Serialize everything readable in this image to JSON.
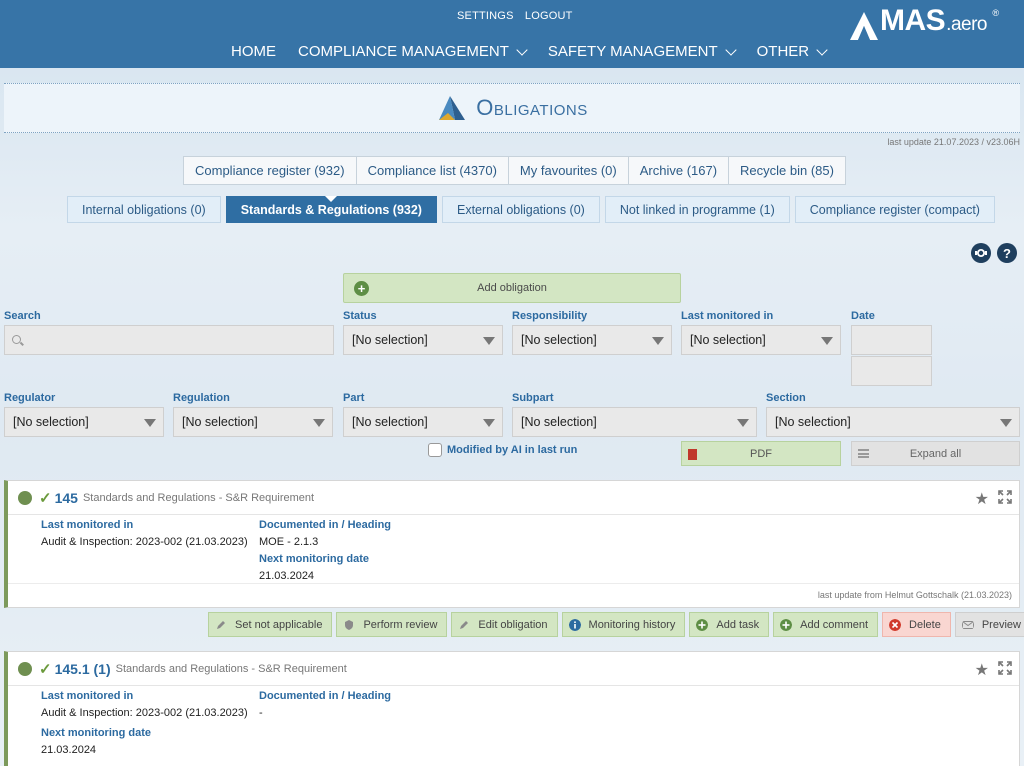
{
  "header": {
    "util_links": [
      "SETTINGS",
      "LOGOUT"
    ],
    "nav": [
      {
        "label": "HOME",
        "dropdown": false
      },
      {
        "label": "COMPLIANCE MANAGEMENT",
        "dropdown": true
      },
      {
        "label": "SAFETY MANAGEMENT",
        "dropdown": true
      },
      {
        "label": "OTHER",
        "dropdown": true
      }
    ],
    "logo_text": "MAS",
    "logo_suffix": ".aero",
    "logo_reg": "®"
  },
  "page": {
    "title": "Obligations",
    "last_update": "last update 21.07.2023 / v23.06H"
  },
  "tabs_primary": [
    "Compliance register (932)",
    "Compliance list (4370)",
    "My favourites (0)",
    "Archive (167)",
    "Recycle bin (85)"
  ],
  "tabs_secondary": [
    {
      "label": "Internal obligations (0)",
      "active": false
    },
    {
      "label": "Standards & Regulations (932)",
      "active": true
    },
    {
      "label": "External obligations (0)",
      "active": false
    },
    {
      "label": "Not linked in programme (1)",
      "active": false
    },
    {
      "label": "Compliance register (compact)",
      "active": false
    }
  ],
  "help": {
    "question": "?"
  },
  "add_button": "Add obligation",
  "filters": {
    "search_label": "Search",
    "search_value": "",
    "status_label": "Status",
    "status_value": "[No selection]",
    "responsibility_label": "Responsibility",
    "responsibility_value": "[No selection]",
    "last_monitored_label": "Last monitored in",
    "last_monitored_value": "[No selection]",
    "date_label": "Date",
    "regulator_label": "Regulator",
    "regulator_value": "[No selection]",
    "regulation_label": "Regulation",
    "regulation_value": "[No selection]",
    "part_label": "Part",
    "part_value": "[No selection]",
    "subpart_label": "Subpart",
    "subpart_value": "[No selection]",
    "section_label": "Section",
    "section_value": "[No selection]",
    "ai_checkbox_label": "Modified by AI in last run",
    "pdf_label": "PDF",
    "expand_label": "Expand all"
  },
  "cards": [
    {
      "number": "145",
      "type": "Standards and Regulations - S&R Requirement",
      "last_monitored_label": "Last monitored in",
      "last_monitored_value": "Audit & Inspection: 2023-002 (21.03.2023)",
      "documented_label": "Documented in / Heading",
      "documented_value": "MOE - 2.1.3",
      "next_label": "Next monitoring date",
      "next_value": "21.03.2024",
      "footer": "last update from Helmut Gottschalk (21.03.2023)"
    },
    {
      "number": "145.1 (1)",
      "type": "Standards and Regulations - S&R Requirement",
      "last_monitored_label": "Last monitored in",
      "last_monitored_value": "Audit & Inspection: 2023-002 (21.03.2023)",
      "documented_label": "Documented in / Heading",
      "documented_value": "-",
      "next_label": "Next monitoring date",
      "next_value": "21.03.2024"
    }
  ],
  "actions": [
    {
      "label": "Set not applicable",
      "icon": "pencil-icon",
      "color": "#8a8a8a",
      "style": "green"
    },
    {
      "label": "Perform review",
      "icon": "shield-icon",
      "color": "#8a8a8a",
      "style": "green"
    },
    {
      "label": "Edit obligation",
      "icon": "pencil-icon",
      "color": "#8a8a8a",
      "style": "green"
    },
    {
      "label": "Monitoring history",
      "icon": "info-icon",
      "color": "#2c6aa0",
      "style": "green"
    },
    {
      "label": "Add task",
      "icon": "plus-circle-icon",
      "color": "#5e8e45",
      "style": "green"
    },
    {
      "label": "Add comment",
      "icon": "plus-circle-icon",
      "color": "#5e8e45",
      "style": "green"
    },
    {
      "label": "Delete",
      "icon": "close-circle-icon",
      "color": "#d0392b",
      "style": "red"
    },
    {
      "label": "Preview Mail",
      "icon": "envelope-icon",
      "color": "#8a8a8a",
      "style": "grey"
    }
  ],
  "colors": {
    "header_bg": "#3774a7",
    "accent": "#2c6aa0",
    "status_ok": "#6f8f50",
    "active_tab": "#2f6ea3"
  }
}
